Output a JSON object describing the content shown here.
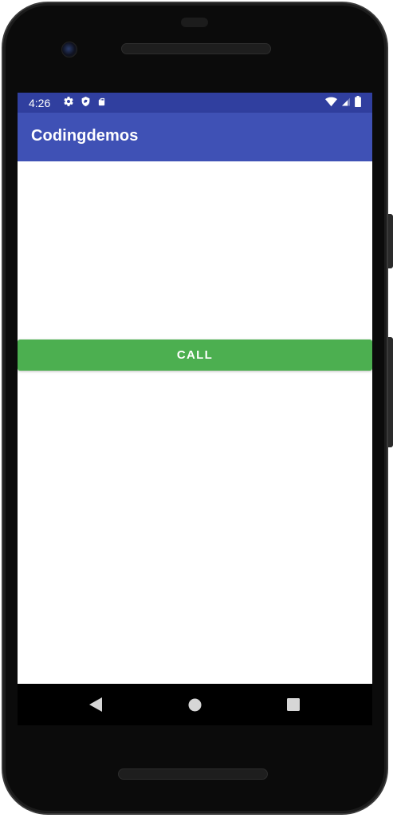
{
  "status_bar": {
    "time": "4:26",
    "icons_left": [
      "settings-icon",
      "shield-icon",
      "sd-card-icon"
    ],
    "icons_right": [
      "wifi-icon",
      "cell-signal-icon",
      "battery-icon"
    ],
    "background_color": "#303f9f"
  },
  "app_bar": {
    "title": "Codingdemos",
    "background_color": "#3f51b5"
  },
  "main": {
    "call_button_label": "CALL",
    "call_button_color": "#4caf50"
  },
  "nav_bar": {
    "buttons": [
      "back-icon",
      "home-icon",
      "recents-icon"
    ]
  }
}
